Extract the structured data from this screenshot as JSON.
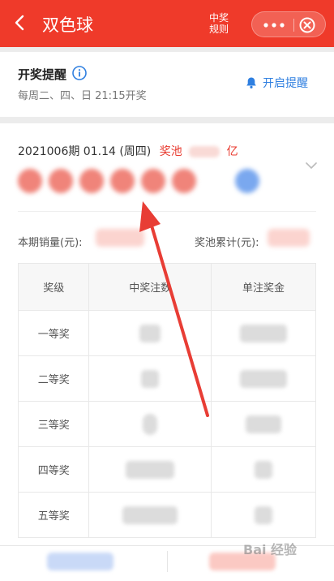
{
  "header": {
    "title": "双色球",
    "rules_label": "中奖\n规则",
    "accent": "#ef3a2a"
  },
  "reminder": {
    "title": "开奖提醒",
    "subtitle": "每周二、四、日 21:15开奖",
    "bell_label": "开启提醒"
  },
  "draw": {
    "issue": "2021006期 01.14 (周四)",
    "pool_label": "奖池",
    "pool_unit": "亿",
    "sales_label": "本期销量(元):",
    "pool_total_label": "奖池累计(元):"
  },
  "table": {
    "headers": [
      "奖级",
      "中奖注数",
      "单注奖金"
    ],
    "rows": [
      {
        "level": "一等奖"
      },
      {
        "level": "二等奖"
      },
      {
        "level": "三等奖"
      },
      {
        "level": "四等奖"
      },
      {
        "level": "五等奖"
      }
    ]
  },
  "watermark": "Bai 经验"
}
